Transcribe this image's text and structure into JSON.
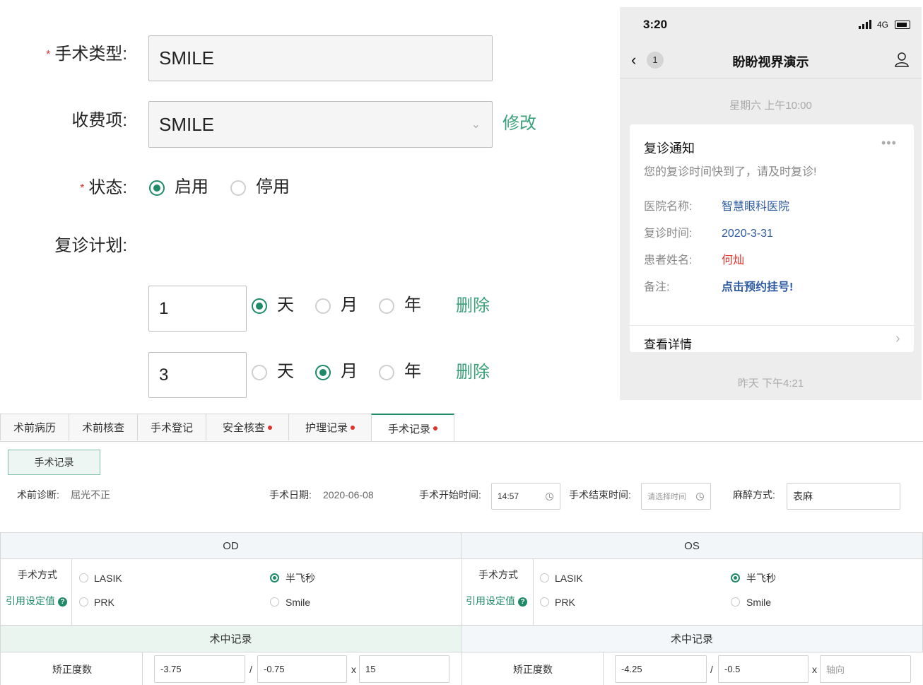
{
  "form": {
    "surgery_type_label": "手术类型:",
    "surgery_type_value": "SMILE",
    "fee_label": "收费项:",
    "fee_value": "SMILE",
    "modify_link": "修改",
    "status_label": "状态:",
    "status_enabled": "启用",
    "status_disabled": "停用",
    "status_selected": "启用",
    "plan_label": "复诊计划:",
    "plans": [
      {
        "value": "1",
        "unit_day": "天",
        "unit_month": "月",
        "unit_year": "年",
        "selected": "天",
        "delete": "删除"
      },
      {
        "value": "3",
        "unit_day": "天",
        "unit_month": "月",
        "unit_year": "年",
        "selected": "月",
        "delete": "删除"
      }
    ]
  },
  "phone": {
    "time": "3:20",
    "network": "4G",
    "back_badge": "1",
    "title": "盼盼视界演示",
    "timestamp_top": "星期六 上午10:00",
    "card": {
      "title": "复诊通知",
      "subtitle": "您的复诊时间快到了，请及时复诊!",
      "rows": [
        {
          "label": "医院名称:",
          "value": "智慧眼科医院",
          "color": "#2c5aa0"
        },
        {
          "label": "复诊时间:",
          "value": "2020-3-31",
          "color": "#2c5aa0"
        },
        {
          "label": "患者姓名:",
          "value": "何灿",
          "color": "#e0302a"
        },
        {
          "label": "备注:",
          "value": "点击预约挂号!",
          "color": "#2c5aa0"
        }
      ],
      "details": "查看详情"
    },
    "timestamp_bottom": "昨天 下午4:21"
  },
  "tabs": [
    {
      "label": "术前病历",
      "dot": false,
      "active": false
    },
    {
      "label": "术前核查",
      "dot": false,
      "active": false
    },
    {
      "label": "手术登记",
      "dot": false,
      "active": false
    },
    {
      "label": "安全核查",
      "dot": true,
      "active": false
    },
    {
      "label": "护理记录",
      "dot": true,
      "active": false
    },
    {
      "label": "手术记录",
      "dot": true,
      "active": true
    }
  ],
  "record": {
    "section_button": "手术记录",
    "pre_diag_label": "术前诊断:",
    "pre_diag_value": "屈光不正",
    "date_label": "手术日期:",
    "date_value": "2020-06-08",
    "start_label": "手术开始时间:",
    "start_value": "14:57",
    "end_label": "手术结束时间:",
    "end_placeholder": "请选择时间",
    "anesthesia_label": "麻醉方式:",
    "anesthesia_value": "表麻",
    "od": "OD",
    "os": "OS",
    "method_label": "手术方式",
    "cite_label": "引用设定值",
    "options": [
      "LASIK",
      "半飞秒",
      "PRK",
      "Smile"
    ],
    "selected_option": "半飞秒",
    "intra_header": "术中记录",
    "correction_label": "矫正度数",
    "od_values": {
      "sphere": "-3.75",
      "cyl": "-0.75",
      "axis": "15"
    },
    "os_values": {
      "sphere": "-4.25",
      "cyl": "-0.5",
      "axis_placeholder": "轴向"
    },
    "slash": "/",
    "x": "x"
  },
  "colors": {
    "accent": "#1f8a66",
    "red": "#e0302a",
    "link_blue": "#2c5aa0"
  }
}
